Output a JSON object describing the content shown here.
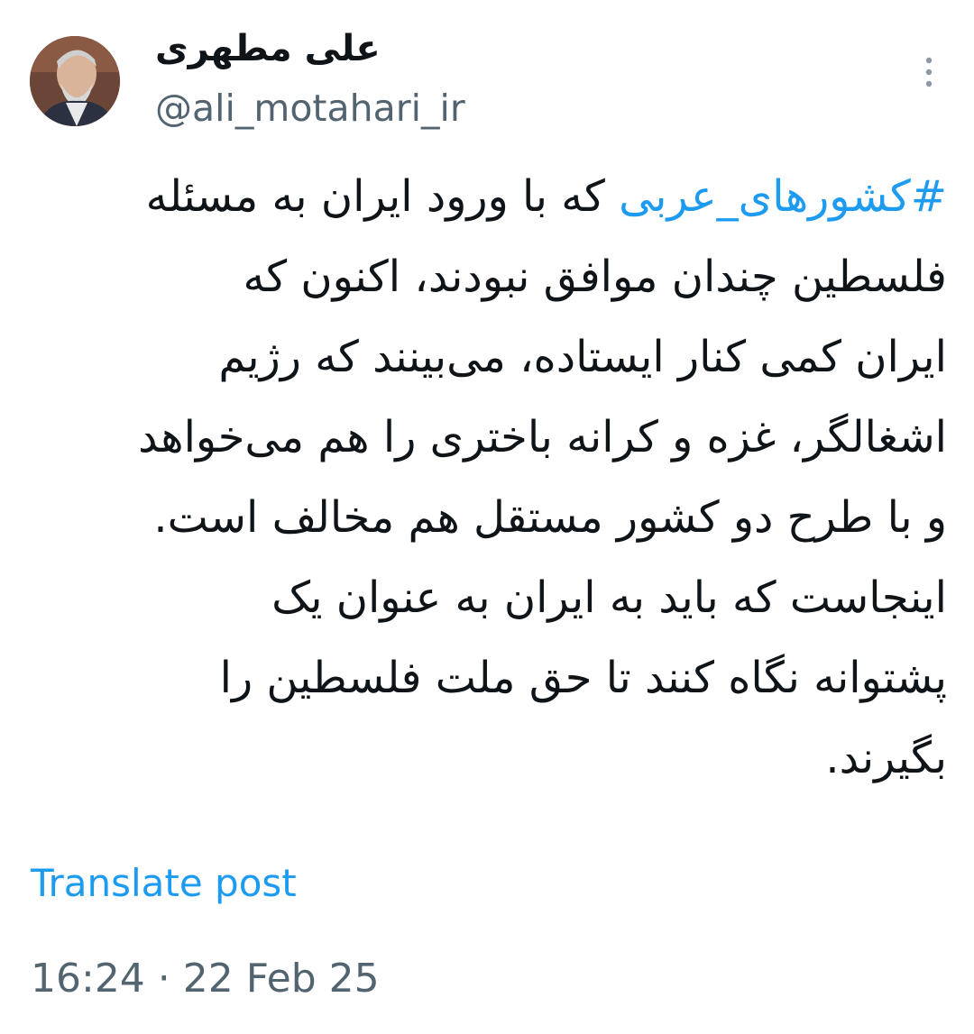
{
  "author": {
    "display_name": "علی مطهری",
    "handle": "@ali_motahari_ir"
  },
  "tweet": {
    "hashtag": "#کشورهای_عربی",
    "line1_rest": " که با ورود ایران به مسئله",
    "lines": [
      "فلسطین چندان موافق نبودند، اکنون که",
      "ایران کمی کنار ایستاده، می‌بینند که رژیم",
      "اشغالگر، غزه و کرانه باختری را هم می‌خواهد",
      "و با طرح دو کشور مستقل هم مخالف است.",
      "اینجاست که باید به ایران به عنوان یک",
      "پشتوانه نگاه کنند تا حق ملت فلسطین را",
      "بگیرند."
    ]
  },
  "translate_label": "Translate post",
  "timestamp": "16:24 · 22 Feb 25",
  "colors": {
    "accent": "#1d9bf0",
    "secondary_text": "#536471",
    "primary_text": "#0f1419"
  },
  "icons": {
    "more": "more-vertical-icon"
  }
}
